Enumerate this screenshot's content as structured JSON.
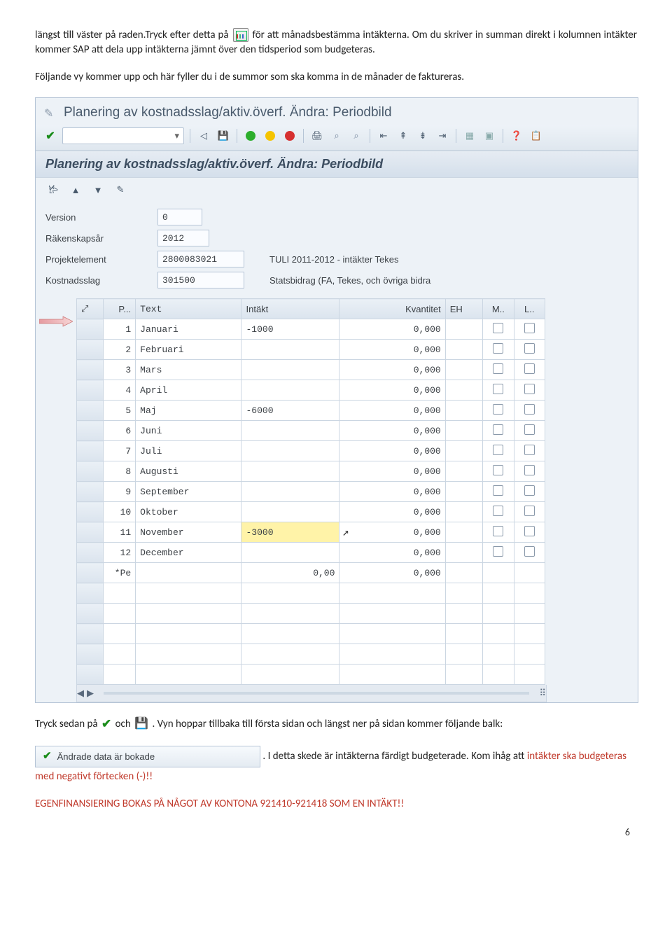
{
  "doc": {
    "p1_a": "längst till väster på raden.Tryck efter detta på ",
    "p1_b": " för att månadsbestämma intäkterna. Om du skriver in summan direkt i kolumnen intäkter kommer SAP att dela upp intäkterna jämnt över den tidsperiod som budgeteras.",
    "p2": "Följande vy kommer upp och här fyller du i de summor som ska komma in de månader de faktureras.",
    "p3_a": "Tryck sedan på ",
    "p3_b": " och ",
    "p3_c": ". Vyn hoppar tillbaka till första sidan och längst ner på sidan kommer följande balk:",
    "p4_a": ". I detta skede är intäkterna färdigt budgeterade. Kom ihåg att ",
    "p4_b_red": "intäkter ska budgeteras med negativt förtecken (-)!!",
    "p5_red": "EGENFINANSIERING BOKAS PÅ NÅGOT AV KONTONA 921410-921418 SOM EN INTÄKT!!",
    "page_number": "6"
  },
  "sap": {
    "title": "Planering av kostnadsslag/aktiv.överf. Ändra: Periodbild",
    "subtitle": "Planering av kostnadsslag/aktiv.överf. Ändra: Periodbild",
    "fields": {
      "version_label": "Version",
      "version_value": "0",
      "year_label": "Räkenskapsår",
      "year_value": "2012",
      "projekt_label": "Projektelement",
      "projekt_value": "2800083021",
      "projekt_desc": "TULI 2011-2012 - intäkter Tekes",
      "kostnad_label": "Kostnadsslag",
      "kostnad_value": "301500",
      "kostnad_desc": "Statsbidrag (FA, Tekes, och övriga bidra"
    },
    "cols": {
      "select": "",
      "p": "P...",
      "text": "Text",
      "intakt": "Intäkt",
      "kvant": "Kvantitet",
      "eh": "EH",
      "m": "M..",
      "l": "L.."
    },
    "rows": [
      {
        "p": "1",
        "text": "Januari",
        "intakt": "-1000",
        "kvant": "0,000",
        "chk": true
      },
      {
        "p": "2",
        "text": "Februari",
        "intakt": "",
        "kvant": "0,000",
        "chk": true
      },
      {
        "p": "3",
        "text": "Mars",
        "intakt": "",
        "kvant": "0,000",
        "chk": true
      },
      {
        "p": "4",
        "text": "April",
        "intakt": "",
        "kvant": "0,000",
        "chk": true
      },
      {
        "p": "5",
        "text": "Maj",
        "intakt": "-6000",
        "kvant": "0,000",
        "chk": true
      },
      {
        "p": "6",
        "text": "Juni",
        "intakt": "",
        "kvant": "0,000",
        "chk": true
      },
      {
        "p": "7",
        "text": "Juli",
        "intakt": "",
        "kvant": "0,000",
        "chk": true
      },
      {
        "p": "8",
        "text": "Augusti",
        "intakt": "",
        "kvant": "0,000",
        "chk": true
      },
      {
        "p": "9",
        "text": "September",
        "intakt": "",
        "kvant": "0,000",
        "chk": true
      },
      {
        "p": "10",
        "text": "Oktober",
        "intakt": "",
        "kvant": "0,000",
        "chk": true
      },
      {
        "p": "11",
        "text": "November",
        "intakt": "-3000",
        "kvant": "0,000",
        "chk": true,
        "highlight": true,
        "cursor": true
      },
      {
        "p": "12",
        "text": "December",
        "intakt": "",
        "kvant": "0,000",
        "chk": true
      },
      {
        "p": "*Pe",
        "text": "",
        "intakt": "0,00",
        "kvant": "0,000",
        "chk": false,
        "sumRight": true
      }
    ],
    "status_text": "Ändrade data är bokade"
  }
}
